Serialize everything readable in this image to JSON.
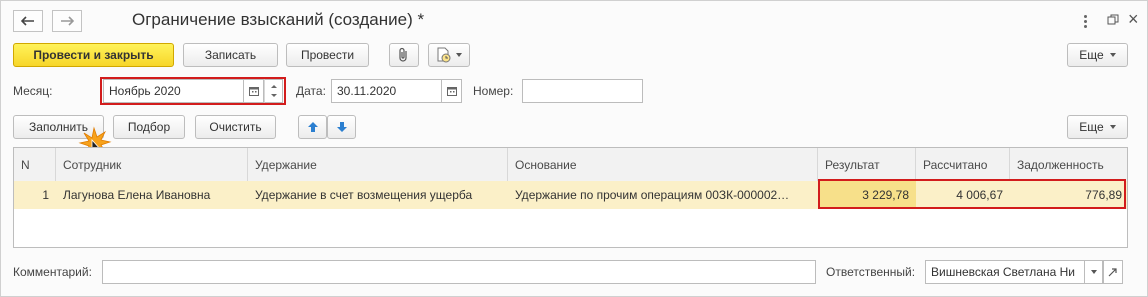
{
  "header": {
    "title": "Ограничение взысканий (создание) *",
    "back_icon": "arrow-left",
    "forward_icon": "arrow-right",
    "menu_icon": "kebab-vertical",
    "expand_icon": "restore",
    "close_label": "×"
  },
  "toolbar": {
    "post_close": "Провести и закрыть",
    "save": "Записать",
    "post": "Провести",
    "attach_icon": "paperclip",
    "report_icon": "document-clock",
    "more": "Еще"
  },
  "form": {
    "month_label": "Месяц:",
    "month_value": "Ноябрь 2020",
    "date_label": "Дата:",
    "date_value": "30.11.2020",
    "number_label": "Номер:",
    "number_value": ""
  },
  "table_toolbar": {
    "fill": "Заполнить",
    "select": "Подбор",
    "clear": "Очистить",
    "up_icon": "arrow-up",
    "down_icon": "arrow-down",
    "more": "Еще"
  },
  "table": {
    "columns": [
      "N",
      "Сотрудник",
      "Удержание",
      "Основание",
      "Результат",
      "Рассчитано",
      "Задолженность"
    ],
    "rows": [
      {
        "n": "1",
        "employee": "Лагунова Елена Ивановна",
        "deduction": "Удержание в счет возмещения ущерба",
        "basis": "Удержание по прочим операциям 00ЗК-000002…",
        "result": "3 229,78",
        "calculated": "4 006,67",
        "debt": "776,89"
      }
    ]
  },
  "footer": {
    "comment_label": "Комментарий:",
    "comment_value": "",
    "responsible_label": "Ответственный:",
    "responsible_value": "Вишневская Светлана Ни"
  },
  "colors": {
    "primary_button": "#f7d62a",
    "row_selected": "#fbf0c8",
    "highlight": "#d21c1c",
    "arrow_blue": "#2b7fd0"
  }
}
